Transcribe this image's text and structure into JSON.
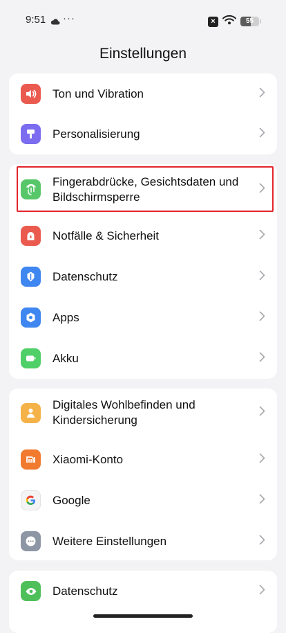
{
  "status_bar": {
    "time": "9:51",
    "dots": "···",
    "battery_level": "55",
    "battery_fraction": 0.55
  },
  "header": {
    "title": "Einstellungen"
  },
  "groups": [
    {
      "items": [
        {
          "label": "Ton und Vibration",
          "icon": "speaker-icon",
          "color": "#ea5a4e"
        },
        {
          "label": "Personalisierung",
          "icon": "paint-roller-icon",
          "color": "#7b6cf0"
        }
      ]
    },
    {
      "items": [
        {
          "label": "Fingerabdrücke, Gesichtsdaten und Bildschirmsperre",
          "icon": "fingerprint-icon",
          "color": "#57c76a",
          "highlighted": true
        },
        {
          "label": "Notfälle & Sicherheit",
          "icon": "emergency-icon",
          "color": "#ea5a4e"
        },
        {
          "label": "Datenschutz",
          "icon": "privacy-icon",
          "color": "#3e86f0"
        },
        {
          "label": "Apps",
          "icon": "apps-gear-icon",
          "color": "#3e86f0"
        },
        {
          "label": "Akku",
          "icon": "battery-icon",
          "color": "#4fcf67"
        }
      ]
    },
    {
      "items": [
        {
          "label": "Digitales Wohlbefinden und Kindersicherung",
          "icon": "wellbeing-icon",
          "color": "#f4b248"
        },
        {
          "label": "Xiaomi-Konto",
          "icon": "xiaomi-icon",
          "color": "#f27a2e"
        },
        {
          "label": "Google",
          "icon": "google-icon",
          "color": "#f4f4f4"
        },
        {
          "label": "Weitere Einstellungen",
          "icon": "more-dots-icon",
          "color": "#8d96a5"
        }
      ]
    },
    {
      "items": [
        {
          "label": "Datenschutz",
          "icon": "eye-icon",
          "color": "#4fbf5a"
        }
      ]
    }
  ]
}
